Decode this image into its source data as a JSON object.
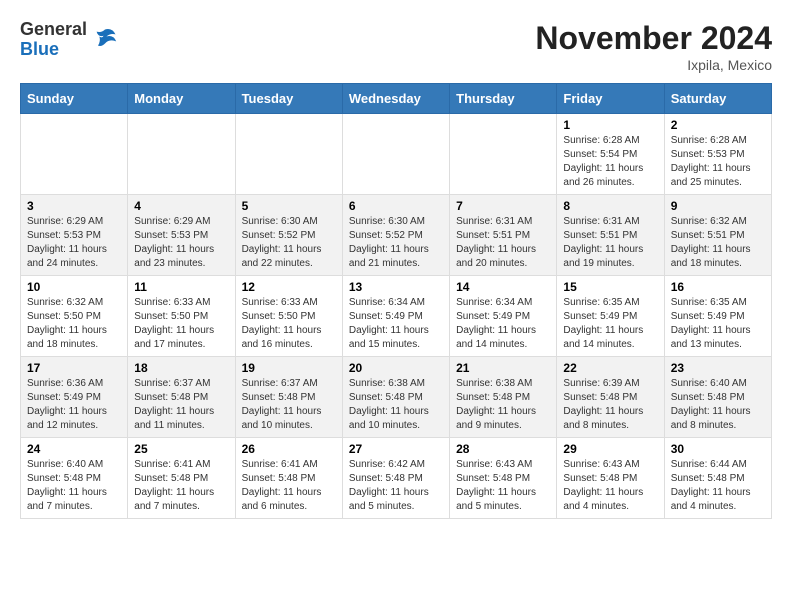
{
  "logo": {
    "general": "General",
    "blue": "Blue"
  },
  "title": "November 2024",
  "subtitle": "Ixpila, Mexico",
  "days_of_week": [
    "Sunday",
    "Monday",
    "Tuesday",
    "Wednesday",
    "Thursday",
    "Friday",
    "Saturday"
  ],
  "weeks": [
    [
      {
        "day": "",
        "info": ""
      },
      {
        "day": "",
        "info": ""
      },
      {
        "day": "",
        "info": ""
      },
      {
        "day": "",
        "info": ""
      },
      {
        "day": "",
        "info": ""
      },
      {
        "day": "1",
        "info": "Sunrise: 6:28 AM\nSunset: 5:54 PM\nDaylight: 11 hours and 26 minutes."
      },
      {
        "day": "2",
        "info": "Sunrise: 6:28 AM\nSunset: 5:53 PM\nDaylight: 11 hours and 25 minutes."
      }
    ],
    [
      {
        "day": "3",
        "info": "Sunrise: 6:29 AM\nSunset: 5:53 PM\nDaylight: 11 hours and 24 minutes."
      },
      {
        "day": "4",
        "info": "Sunrise: 6:29 AM\nSunset: 5:53 PM\nDaylight: 11 hours and 23 minutes."
      },
      {
        "day": "5",
        "info": "Sunrise: 6:30 AM\nSunset: 5:52 PM\nDaylight: 11 hours and 22 minutes."
      },
      {
        "day": "6",
        "info": "Sunrise: 6:30 AM\nSunset: 5:52 PM\nDaylight: 11 hours and 21 minutes."
      },
      {
        "day": "7",
        "info": "Sunrise: 6:31 AM\nSunset: 5:51 PM\nDaylight: 11 hours and 20 minutes."
      },
      {
        "day": "8",
        "info": "Sunrise: 6:31 AM\nSunset: 5:51 PM\nDaylight: 11 hours and 19 minutes."
      },
      {
        "day": "9",
        "info": "Sunrise: 6:32 AM\nSunset: 5:51 PM\nDaylight: 11 hours and 18 minutes."
      }
    ],
    [
      {
        "day": "10",
        "info": "Sunrise: 6:32 AM\nSunset: 5:50 PM\nDaylight: 11 hours and 18 minutes."
      },
      {
        "day": "11",
        "info": "Sunrise: 6:33 AM\nSunset: 5:50 PM\nDaylight: 11 hours and 17 minutes."
      },
      {
        "day": "12",
        "info": "Sunrise: 6:33 AM\nSunset: 5:50 PM\nDaylight: 11 hours and 16 minutes."
      },
      {
        "day": "13",
        "info": "Sunrise: 6:34 AM\nSunset: 5:49 PM\nDaylight: 11 hours and 15 minutes."
      },
      {
        "day": "14",
        "info": "Sunrise: 6:34 AM\nSunset: 5:49 PM\nDaylight: 11 hours and 14 minutes."
      },
      {
        "day": "15",
        "info": "Sunrise: 6:35 AM\nSunset: 5:49 PM\nDaylight: 11 hours and 14 minutes."
      },
      {
        "day": "16",
        "info": "Sunrise: 6:35 AM\nSunset: 5:49 PM\nDaylight: 11 hours and 13 minutes."
      }
    ],
    [
      {
        "day": "17",
        "info": "Sunrise: 6:36 AM\nSunset: 5:49 PM\nDaylight: 11 hours and 12 minutes."
      },
      {
        "day": "18",
        "info": "Sunrise: 6:37 AM\nSunset: 5:48 PM\nDaylight: 11 hours and 11 minutes."
      },
      {
        "day": "19",
        "info": "Sunrise: 6:37 AM\nSunset: 5:48 PM\nDaylight: 11 hours and 10 minutes."
      },
      {
        "day": "20",
        "info": "Sunrise: 6:38 AM\nSunset: 5:48 PM\nDaylight: 11 hours and 10 minutes."
      },
      {
        "day": "21",
        "info": "Sunrise: 6:38 AM\nSunset: 5:48 PM\nDaylight: 11 hours and 9 minutes."
      },
      {
        "day": "22",
        "info": "Sunrise: 6:39 AM\nSunset: 5:48 PM\nDaylight: 11 hours and 8 minutes."
      },
      {
        "day": "23",
        "info": "Sunrise: 6:40 AM\nSunset: 5:48 PM\nDaylight: 11 hours and 8 minutes."
      }
    ],
    [
      {
        "day": "24",
        "info": "Sunrise: 6:40 AM\nSunset: 5:48 PM\nDaylight: 11 hours and 7 minutes."
      },
      {
        "day": "25",
        "info": "Sunrise: 6:41 AM\nSunset: 5:48 PM\nDaylight: 11 hours and 7 minutes."
      },
      {
        "day": "26",
        "info": "Sunrise: 6:41 AM\nSunset: 5:48 PM\nDaylight: 11 hours and 6 minutes."
      },
      {
        "day": "27",
        "info": "Sunrise: 6:42 AM\nSunset: 5:48 PM\nDaylight: 11 hours and 5 minutes."
      },
      {
        "day": "28",
        "info": "Sunrise: 6:43 AM\nSunset: 5:48 PM\nDaylight: 11 hours and 5 minutes."
      },
      {
        "day": "29",
        "info": "Sunrise: 6:43 AM\nSunset: 5:48 PM\nDaylight: 11 hours and 4 minutes."
      },
      {
        "day": "30",
        "info": "Sunrise: 6:44 AM\nSunset: 5:48 PM\nDaylight: 11 hours and 4 minutes."
      }
    ]
  ]
}
